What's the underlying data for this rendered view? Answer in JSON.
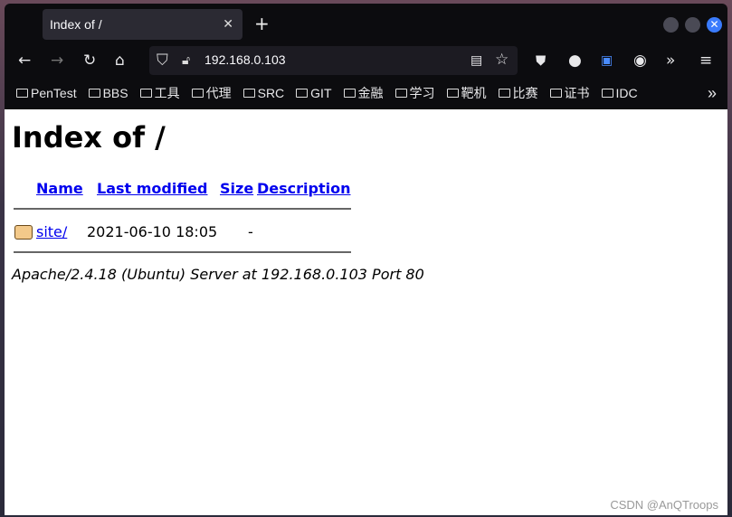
{
  "browser": {
    "tab_title": "Index of /",
    "url": "192.168.0.103",
    "bookmarks": [
      "PenTest",
      "BBS",
      "工具",
      "代理",
      "SRC",
      "GIT",
      "金融",
      "学习",
      "靶机",
      "比赛",
      "证书",
      "IDC"
    ]
  },
  "page": {
    "title": "Index of /",
    "columns": [
      "Name",
      "Last modified",
      "Size",
      "Description"
    ],
    "rows": [
      {
        "name": "site/",
        "modified": "2021-06-10 18:05",
        "size": "-",
        "description": ""
      }
    ],
    "address": "Apache/2.4.18 (Ubuntu) Server at 192.168.0.103 Port 80"
  },
  "watermark": "CSDN @AnQTroops"
}
